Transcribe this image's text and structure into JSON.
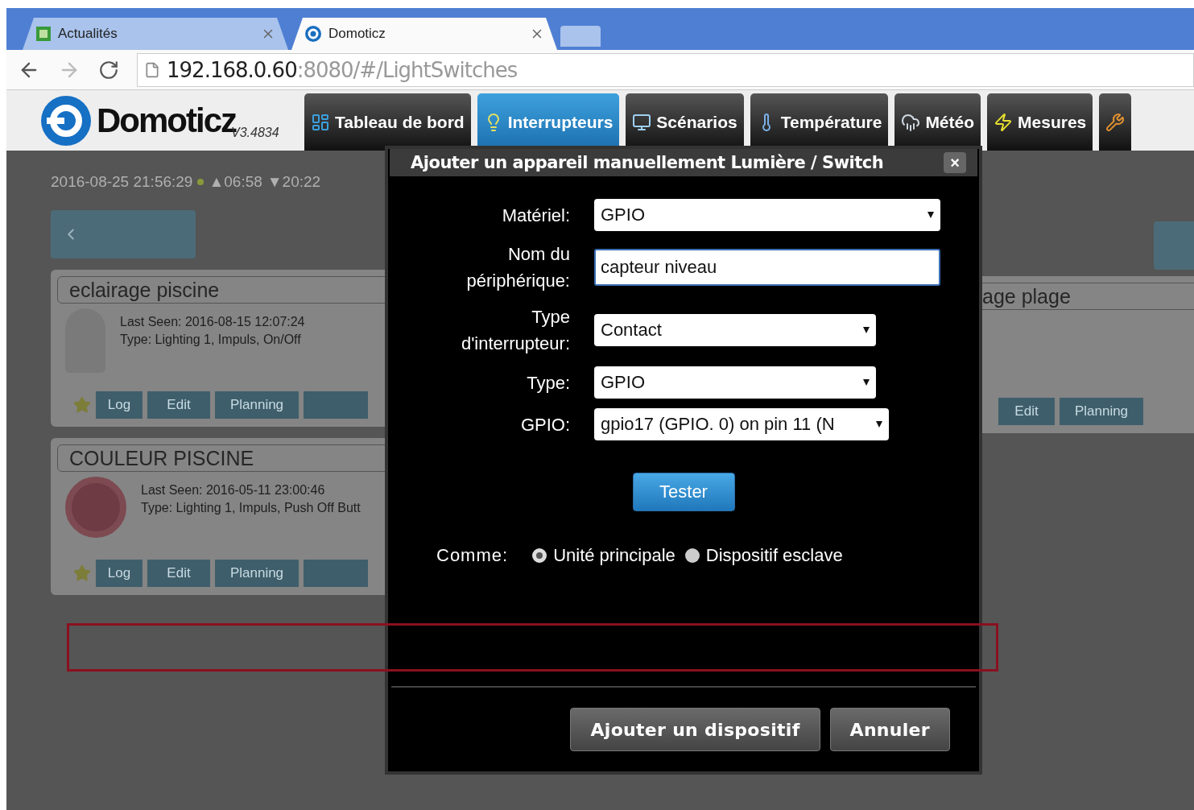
{
  "browser": {
    "tabs": [
      {
        "title": "Actualités",
        "selected": false,
        "kind": "news"
      },
      {
        "title": "Domoticz",
        "selected": true,
        "kind": "app"
      }
    ],
    "url": {
      "host": "192.168.0.60",
      "rest": ":8080/#/LightSwitches"
    }
  },
  "app": {
    "logo": "Domoticz",
    "version": "V3.4834",
    "nav": [
      {
        "label": "Tableau de bord",
        "selected": false,
        "kind": "dashboard"
      },
      {
        "label": "Interrupteurs",
        "selected": true,
        "kind": "bulb"
      },
      {
        "label": "Scénarios",
        "selected": false,
        "kind": "scene"
      },
      {
        "label": "Température",
        "selected": false,
        "kind": "thermometer"
      },
      {
        "label": "Météo",
        "selected": false,
        "kind": "weather"
      },
      {
        "label": "Mesures",
        "selected": false,
        "kind": "measure"
      },
      {
        "selected": false,
        "kind": "tools"
      }
    ]
  },
  "background": {
    "datetime": "2016-08-25 21:56:29",
    "sunrise": "▲06:58",
    "sunset": "▼20:22",
    "cards": [
      {
        "title": "eclairage piscine",
        "kind": "bulb",
        "last_seen": "Last Seen: 2016-08-15 12:07:24",
        "type": "Type: Lighting 1, Impuls, On/Off",
        "buttons": [
          "Log",
          "Edit",
          "Planning"
        ]
      },
      {
        "title": "COULEUR PISCINE",
        "kind": "push",
        "last_seen": "Last Seen: 2016-05-11 23:00:46",
        "type": "Type: Lighting 1, Impuls, Push Off Butt",
        "buttons": [
          "Log",
          "Edit",
          "Planning"
        ]
      }
    ],
    "right_card": {
      "title": "age plage",
      "buttons": [
        "Edit",
        "Planning"
      ]
    }
  },
  "dialog": {
    "title": "Ajouter un appareil manuellement Lumière / Switch",
    "close": "×",
    "fields": [
      {
        "label": "Matériel:",
        "kind": "select",
        "value": "GPIO"
      },
      {
        "label": "Nom du périphérique:",
        "kind": "text",
        "value": "capteur niveau"
      },
      {
        "label": "Type d'interrupteur:",
        "kind": "select",
        "value": "Contact"
      },
      {
        "label": "Type:",
        "kind": "select",
        "value": "GPIO"
      },
      {
        "label": "GPIO:",
        "kind": "select",
        "value": "gpio17 (GPIO. 0) on pin 11 (N"
      }
    ],
    "test_button": "Tester",
    "as_label": "Comme:",
    "options": [
      {
        "label": "Unité principale",
        "selected": true
      },
      {
        "label": "Dispositif esclave",
        "selected": false
      }
    ],
    "buttons": [
      "Ajouter un dispositif",
      "Annuler"
    ]
  }
}
